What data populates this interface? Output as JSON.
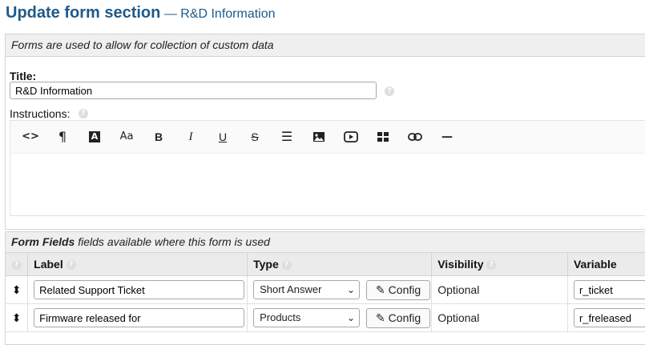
{
  "page": {
    "title": "Update form section",
    "subtitle": "— R&D Information"
  },
  "form": {
    "description": "Forms are used to allow for collection of custom data",
    "title_label": "Title:",
    "title_value": "R&D Information",
    "instructions_label": "Instructions:",
    "help_glyph": "?"
  },
  "editor_toolbar": [
    {
      "name": "code-icon",
      "glyph": "<>"
    },
    {
      "name": "paragraph-icon",
      "glyph": "¶"
    },
    {
      "name": "text-color-icon",
      "glyph": "A"
    },
    {
      "name": "font-size-icon",
      "glyph": "Aa"
    },
    {
      "name": "bold-icon",
      "glyph": "B"
    },
    {
      "name": "italic-icon",
      "glyph": "I"
    },
    {
      "name": "underline-icon",
      "glyph": "U"
    },
    {
      "name": "strikethrough-icon",
      "glyph": "S"
    },
    {
      "name": "list-icon",
      "glyph": "☰"
    },
    {
      "name": "image-icon",
      "glyph": "▣"
    },
    {
      "name": "video-icon",
      "glyph": "▶"
    },
    {
      "name": "table-icon",
      "glyph": "▦"
    },
    {
      "name": "link-icon",
      "glyph": "⊂⊃"
    },
    {
      "name": "horizontal-rule-icon",
      "glyph": "—"
    }
  ],
  "form_fields": {
    "header_bold": "Form Fields",
    "header_rest": "fields available where this form is used",
    "columns": {
      "label": "Label",
      "type": "Type",
      "visibility": "Visibility",
      "variable": "Variable"
    },
    "rows": [
      {
        "label": "Related Support Ticket",
        "type": "Short Answer",
        "config": "Config",
        "visibility": "Optional",
        "variable": "r_ticket"
      },
      {
        "label": "Firmware released for",
        "type": "Products",
        "config": "Config",
        "visibility": "Optional",
        "variable": "r_freleased"
      }
    ]
  },
  "colors": {
    "title": "#1e5a8a",
    "panel_header": "#f0f0f0",
    "border": "#d4d4d4"
  }
}
